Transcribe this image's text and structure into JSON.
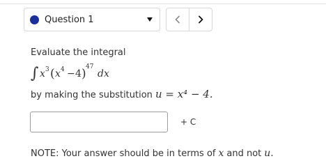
{
  "nav": {
    "question_label": "Question 1",
    "status_color": "#1a2f9c",
    "prev_icon": "chevron-left-icon",
    "next_icon": "chevron-right-icon",
    "dropdown_icon": "caret-down-icon"
  },
  "question": {
    "instruction": "Evaluate the integral",
    "integral": {
      "integrand_power": "3",
      "inner_power": "4",
      "constant": "4",
      "outer_power": "47",
      "differential": "dx"
    },
    "substitution_prefix": "by making the substitution",
    "substitution_formula": "u = x⁴ − 4."
  },
  "answer": {
    "value": "",
    "placeholder": "",
    "constant_label": "+ C"
  },
  "note": {
    "prefix": "NOTE: Your answer should be in terms of",
    "var_x": "x",
    "middle": "and not",
    "var_u": "u."
  }
}
